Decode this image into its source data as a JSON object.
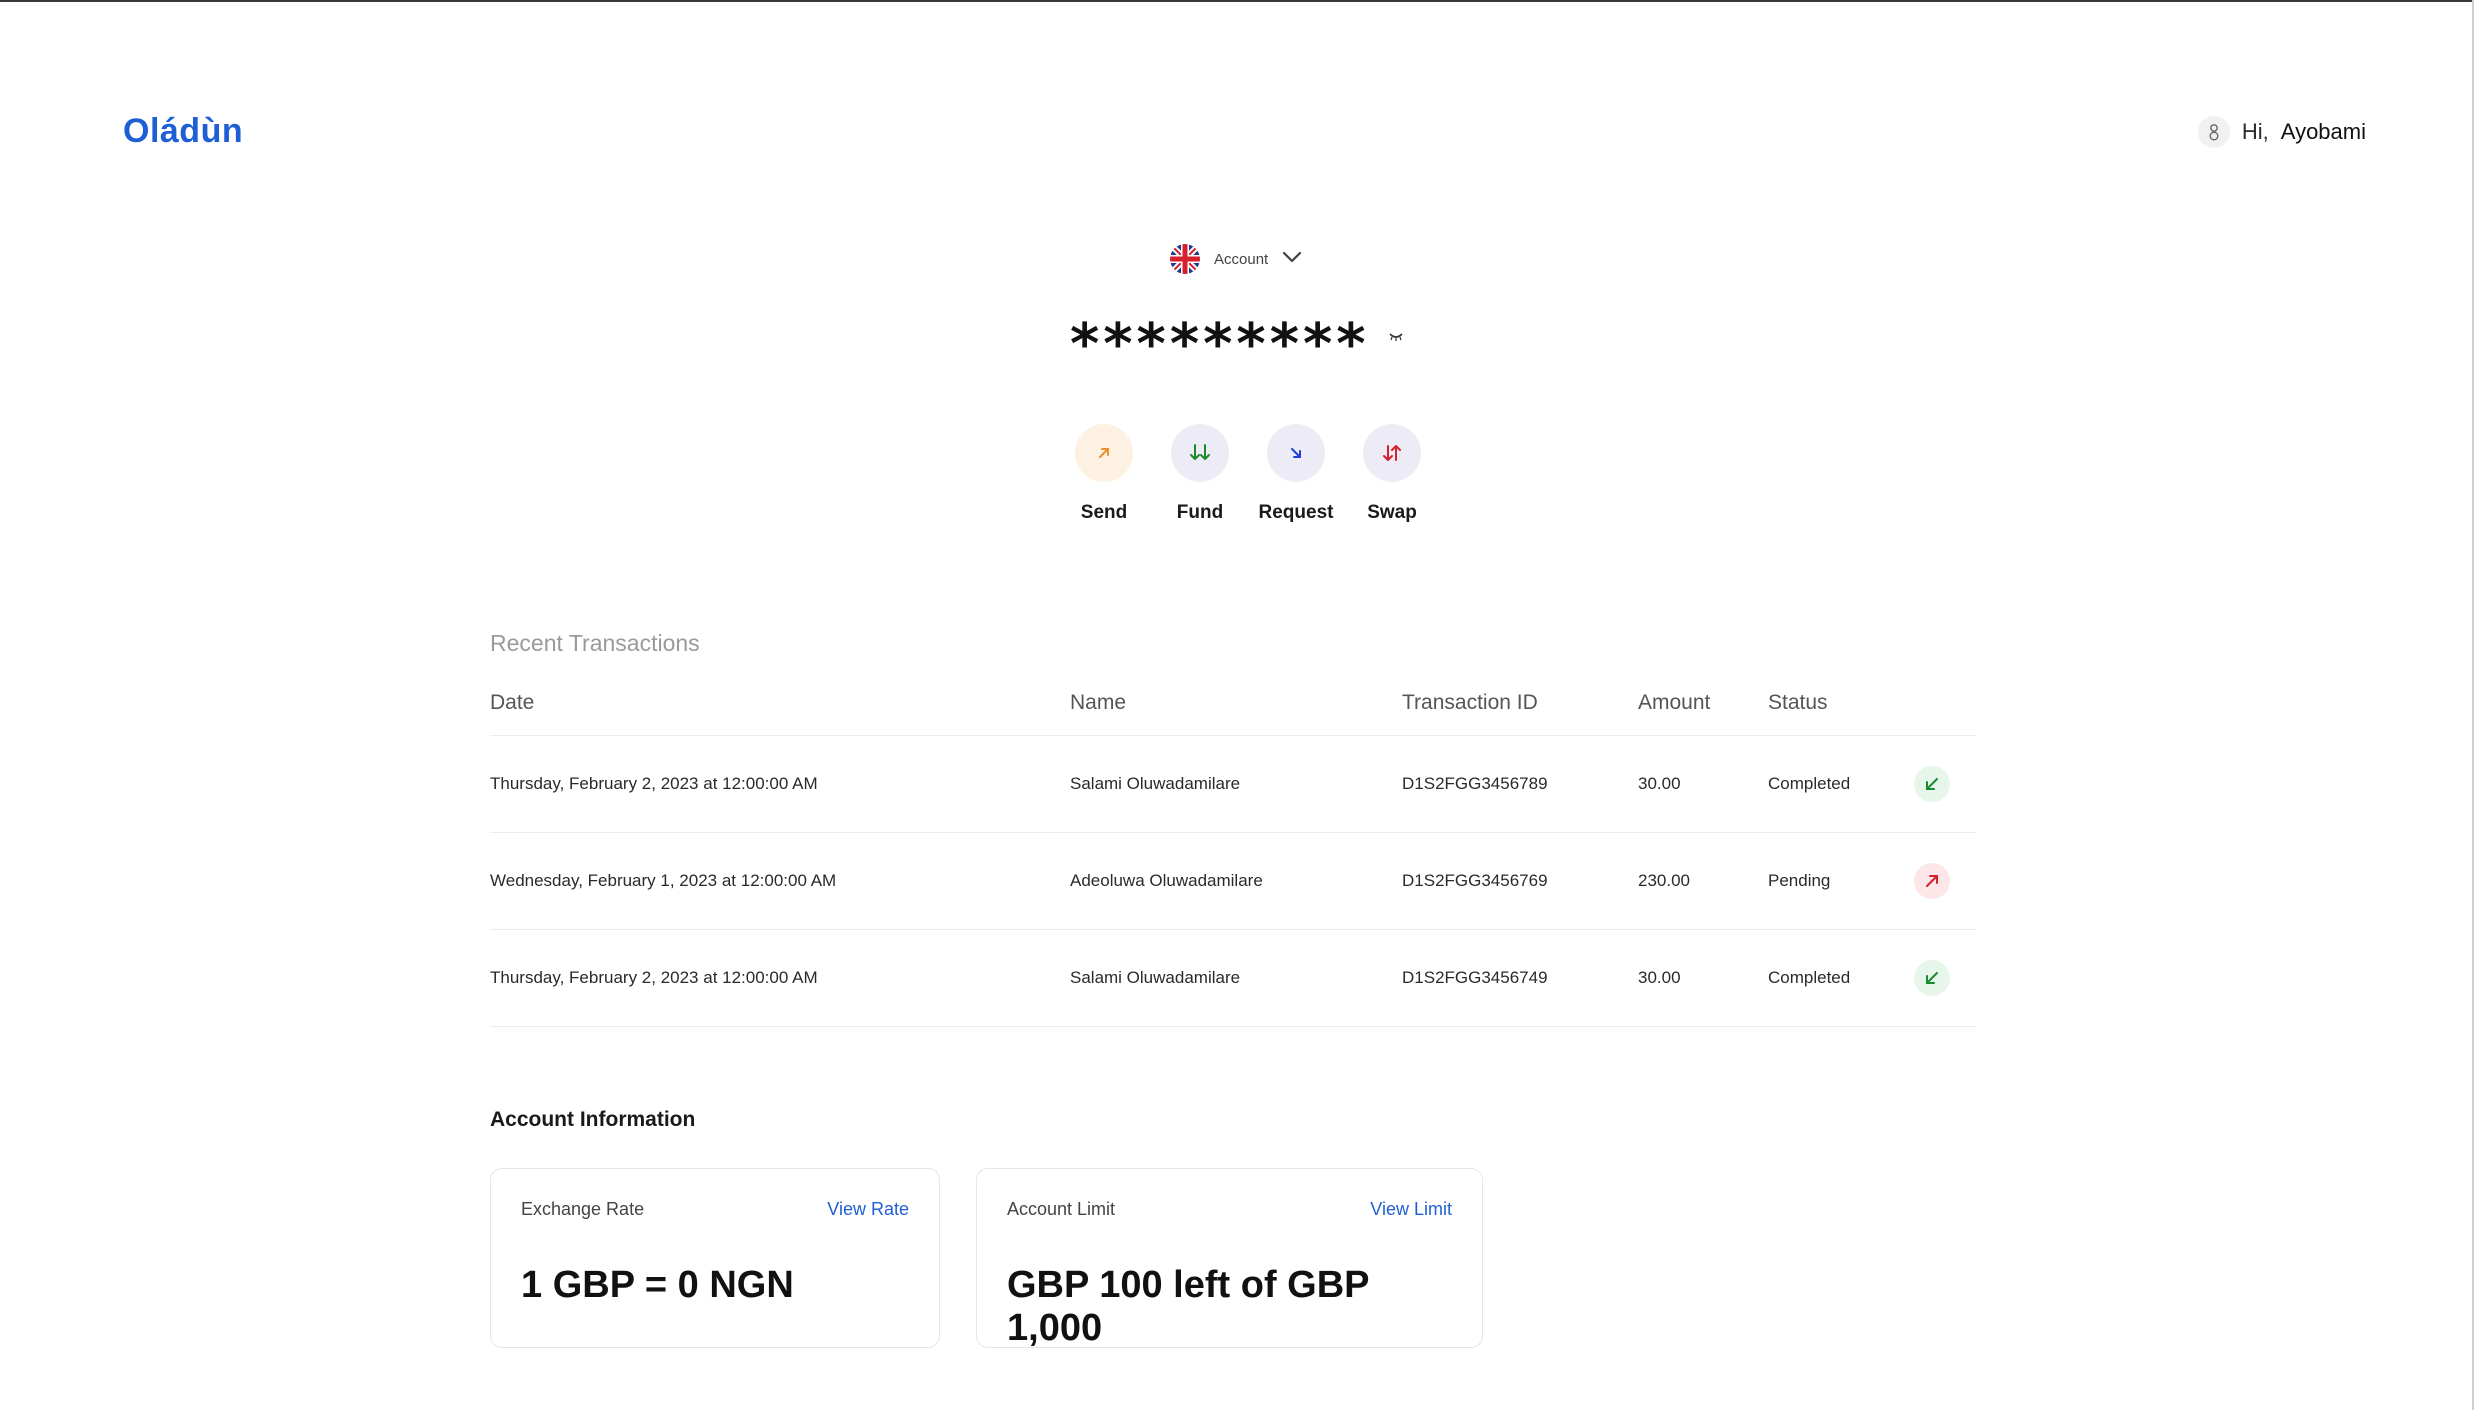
{
  "header": {
    "logo": "Oládùn",
    "greeting": "Hi,",
    "username": "Ayobami",
    "avatar_icon": "user-icon"
  },
  "account_selector": {
    "label": "Account",
    "flag_icon": "uk-flag-icon",
    "chevron_icon": "chevron-down-icon"
  },
  "balance": {
    "masked_value": "*********",
    "toggle_icon": "eye-closed-icon"
  },
  "actions": [
    {
      "label": "Send",
      "icon": "arrow-up-right-icon",
      "bg": "#fdf1e3",
      "color": "#e8922b"
    },
    {
      "label": "Fund",
      "icon": "arrows-down-icon",
      "bg": "#ecebf6",
      "color": "#1a8a2e"
    },
    {
      "label": "Request",
      "icon": "arrow-down-right-icon",
      "bg": "#ecebf6",
      "color": "#1f3fd6"
    },
    {
      "label": "Swap",
      "icon": "swap-icon",
      "bg": "#ecebf6",
      "color": "#d61f2f"
    }
  ],
  "transactions": {
    "heading": "Recent Transactions",
    "columns": [
      "Date",
      "Name",
      "Transaction ID",
      "Amount",
      "Status"
    ],
    "rows": [
      {
        "date": "Thursday, February 2, 2023 at 12:00:00 AM",
        "name": "Salami Oluwadamilare",
        "id": "D1S2FGG3456789",
        "amount": "30.00",
        "status": "Completed",
        "direction": "incoming"
      },
      {
        "date": "Wednesday, February 1, 2023 at 12:00:00 AM",
        "name": "Adeoluwa Oluwadamilare",
        "id": "D1S2FGG3456769",
        "amount": "230.00",
        "status": "Pending",
        "direction": "outgoing"
      },
      {
        "date": "Thursday, February 2, 2023 at 12:00:00 AM",
        "name": "Salami Oluwadamilare",
        "id": "D1S2FGG3456749",
        "amount": "30.00",
        "status": "Completed",
        "direction": "incoming"
      }
    ]
  },
  "account_info": {
    "title": "Account Information",
    "exchange": {
      "title": "Exchange Rate",
      "link": "View Rate",
      "value": "1 GBP = 0 NGN"
    },
    "limit": {
      "title": "Account Limit",
      "link": "View Limit",
      "value": "GBP 100 left of GBP 1,000"
    }
  },
  "colors": {
    "brand": "#1f5fd6",
    "incoming": "#1a8a2e",
    "outgoing": "#d61f2f"
  }
}
